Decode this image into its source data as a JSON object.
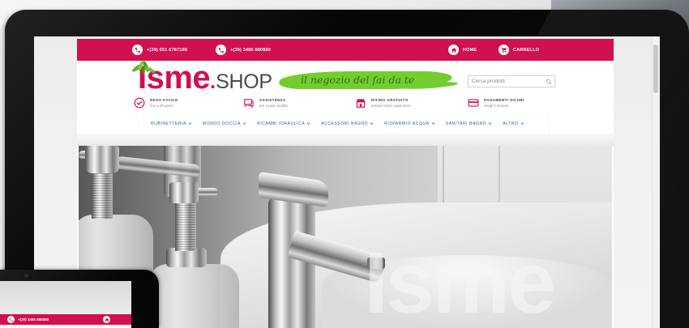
{
  "topbar": {
    "phone_primary": "+(39) 051 6787198",
    "phone_mobile": "+(39) 3485 880880",
    "home_label": "HOME",
    "cart_label": "CARRELLO",
    "icons": [
      "phone-icon",
      "mobile-phone-icon",
      "home-icon",
      "cart-icon"
    ]
  },
  "header": {
    "logo": {
      "brand": "Isme",
      "dot": ".",
      "suffix": "SHOP"
    },
    "slogan": "il negozio del fai da te",
    "search": {
      "placeholder": "Cerca prodotti",
      "icon": "search-icon"
    }
  },
  "features": [
    {
      "title": "RESO FACILE",
      "subtitle": "fino a 30 giorni",
      "icon": "check-circle-icon"
    },
    {
      "title": "ASSISTENZA",
      "subtitle": "pre e post vendita",
      "icon": "chat-icon"
    },
    {
      "title": "RITIRO GRATUITO",
      "subtitle": "presso nostro superstore",
      "icon": "store-icon"
    },
    {
      "title": "PAGAMENTI SICURI",
      "subtitle": "scegli il metodo",
      "icon": "credit-card-icon"
    }
  ],
  "nav": [
    {
      "label": "RUBINETTERIA"
    },
    {
      "label": "MONDO DOCCIA"
    },
    {
      "label": "RICAMBI IDRAULICA"
    },
    {
      "label": "ACCESSORI BAGNO"
    },
    {
      "label": "RISPARMIO ACQUA"
    },
    {
      "label": "SANITARI BAGNO"
    },
    {
      "label": "ALTRO"
    }
  ],
  "hero": {
    "watermark": "Isme"
  },
  "phone_mockup": {
    "number": "+(39) 3485 880880"
  },
  "colors": {
    "brand_red": "#d1104f",
    "brand_green": "#74cd2e",
    "nav_text": "#2d5c9a",
    "device_bezel": "#0a0a0a"
  }
}
